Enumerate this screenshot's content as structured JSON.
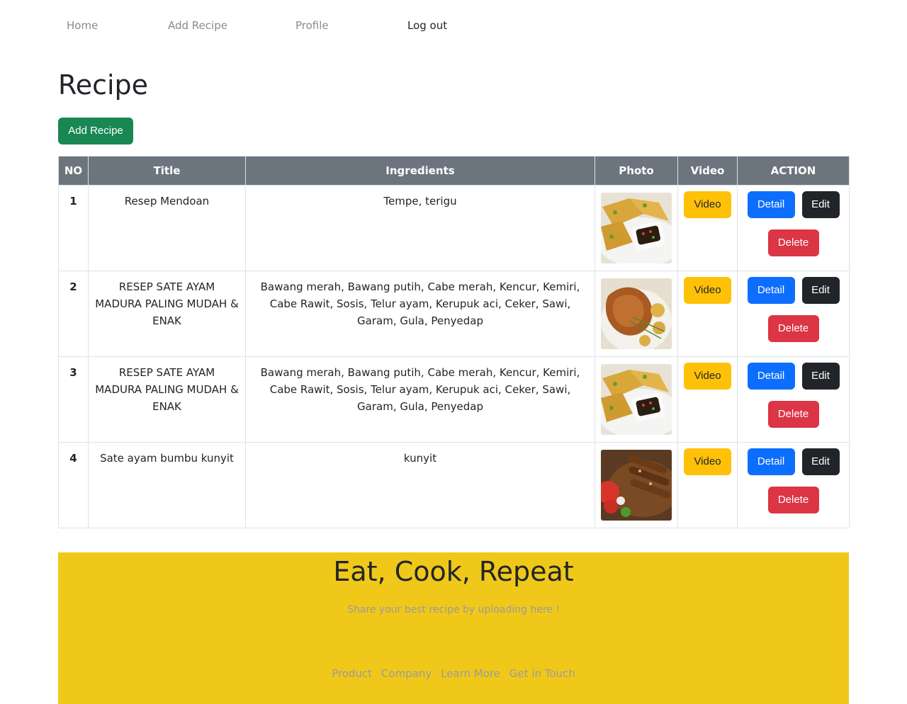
{
  "nav": {
    "items": [
      {
        "label": "Home"
      },
      {
        "label": "Add Recipe"
      },
      {
        "label": "Profile"
      },
      {
        "label": "Log out"
      }
    ]
  },
  "page": {
    "title": "Recipe",
    "add_button": "Add Recipe"
  },
  "table": {
    "headers": [
      "NO",
      "Title",
      "Ingredients",
      "Photo",
      "Video",
      "ACTION"
    ],
    "rows": [
      {
        "no": "1",
        "title": "Resep Mendoan",
        "ingredients": "Tempe, terigu",
        "photo": "mendoan-photo",
        "video": "Video",
        "detail": "Detail",
        "edit": "Edit",
        "delete": "Delete"
      },
      {
        "no": "2",
        "title": "RESEP SATE AYAM MADURA PALING MUDAH & ENAK",
        "ingredients": "Bawang merah, Bawang putih, Cabe merah, Kencur, Kemiri, Cabe Rawit, Sosis, Telur ayam, Kerupuk aci, Ceker, Sawi, Garam, Gula, Penyedap",
        "photo": "roast-chicken-photo",
        "video": "Video",
        "detail": "Detail",
        "edit": "Edit",
        "delete": "Delete"
      },
      {
        "no": "3",
        "title": "RESEP SATE AYAM MADURA PALING MUDAH & ENAK",
        "ingredients": "Bawang merah, Bawang putih, Cabe merah, Kencur, Kemiri, Cabe Rawit, Sosis, Telur ayam, Kerupuk aci, Ceker, Sawi, Garam, Gula, Penyedap",
        "photo": "mendoan-photo",
        "video": "Video",
        "detail": "Detail",
        "edit": "Edit",
        "delete": "Delete"
      },
      {
        "no": "4",
        "title": "Sate ayam bumbu kunyit",
        "ingredients": "kunyit",
        "photo": "satay-photo",
        "video": "Video",
        "detail": "Detail",
        "edit": "Edit",
        "delete": "Delete"
      }
    ]
  },
  "footer": {
    "title": "Eat, Cook, Repeat",
    "tagline": "Share your best recipe by uploading here !",
    "links": [
      "Product",
      "Company",
      "Learn More",
      "Get in Touch"
    ]
  },
  "colors": {
    "header_bg": "#6c757d",
    "footer_bg": "#f0c819",
    "success": "#198754",
    "warning": "#ffc107",
    "primary": "#0d6efd",
    "dark": "#212529",
    "danger": "#dc3545"
  }
}
